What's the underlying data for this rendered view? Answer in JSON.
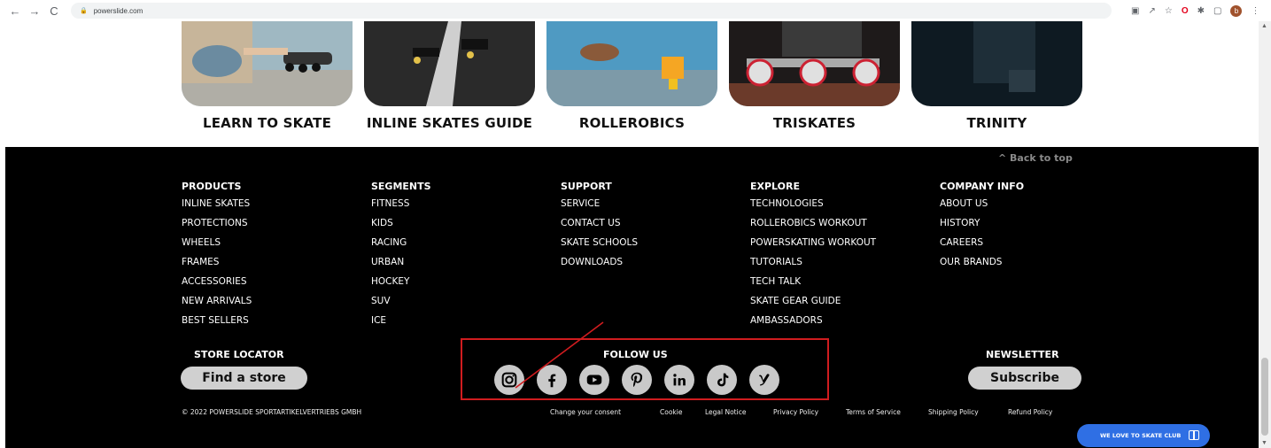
{
  "browser": {
    "url": "powerslide.com",
    "nav": {
      "back": "←",
      "forward": "→",
      "reload": "C"
    }
  },
  "cards": [
    {
      "label": "LEARN TO SKATE"
    },
    {
      "label": "INLINE SKATES GUIDE"
    },
    {
      "label": "ROLLEROBICS"
    },
    {
      "label": "TRISKATES"
    },
    {
      "label": "TRINITY"
    }
  ],
  "footer": {
    "back_to_top": "^ Back to top",
    "columns": [
      {
        "title": "PRODUCTS",
        "links": [
          "INLINE SKATES",
          "PROTECTIONS",
          "WHEELS",
          "FRAMES",
          "ACCESSORIES",
          "NEW ARRIVALS",
          "BEST SELLERS"
        ]
      },
      {
        "title": "SEGMENTS",
        "links": [
          "FITNESS",
          "KIDS",
          "RACING",
          "URBAN",
          "HOCKEY",
          "SUV",
          "ICE"
        ]
      },
      {
        "title": "SUPPORT",
        "links": [
          "SERVICE",
          "CONTACT US",
          "SKATE SCHOOLS",
          "DOWNLOADS"
        ]
      },
      {
        "title": "EXPLORE",
        "links": [
          "TECHNOLOGIES",
          "ROLLEROBICS WORKOUT",
          "POWERSKATING WORKOUT",
          "TUTORIALS",
          "TECH TALK",
          "SKATE GEAR GUIDE",
          "AMBASSADORS"
        ]
      },
      {
        "title": "COMPANY INFO",
        "links": [
          "ABOUT US",
          "HISTORY",
          "CAREERS",
          "OUR BRANDS"
        ]
      }
    ],
    "store_locator": {
      "title": "STORE LOCATOR",
      "button": "Find a store"
    },
    "follow_us": {
      "title": "FOLLOW US",
      "networks": [
        "instagram-icon",
        "facebook-icon",
        "youtube-icon",
        "pinterest-icon",
        "linkedin-icon",
        "tiktok-icon",
        "y-brand-icon"
      ]
    },
    "newsletter": {
      "title": "NEWSLETTER",
      "button": "Subscribe"
    },
    "copyright": "© 2022 POWERSLIDE SPORTARTIKELVERTRIEBS GMBH",
    "legal_links": [
      "Change your consent",
      "Cookie",
      "Legal Notice",
      "Privacy Policy",
      "Terms of Service",
      "Shipping Policy",
      "Refund Policy"
    ],
    "club_button": "WE LOVE TO SKATE CLUB"
  },
  "colors": {
    "footer_bg": "#000000",
    "pill_bg": "#d0d0d0",
    "annotation_red": "#d01c1f",
    "club_blue": "#2f6fe4"
  }
}
